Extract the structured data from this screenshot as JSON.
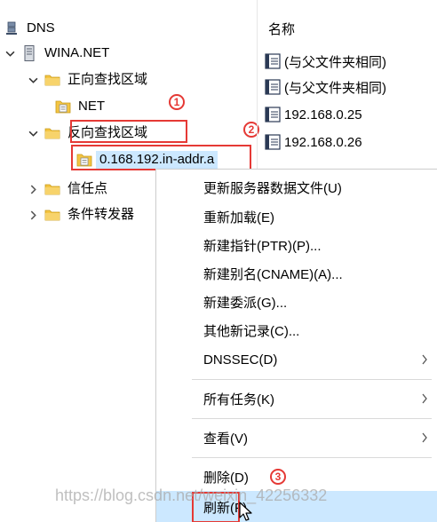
{
  "tree": {
    "root": {
      "label": "DNS",
      "icon": "dns-server-icon"
    },
    "server": {
      "label": "WINA.NET",
      "icon": "server-icon"
    },
    "forward_zones": {
      "label": "正向查找区域",
      "icon": "folder-icon"
    },
    "forward_zone_net": {
      "label": "NET",
      "icon": "zone-icon"
    },
    "reverse_zones": {
      "label": "反向查找区域",
      "icon": "folder-icon"
    },
    "reverse_zone_selected": {
      "label": "0.168.192.in-addr.a",
      "icon": "zone-icon"
    },
    "trust_points": {
      "label": "信任点",
      "icon": "folder-icon"
    },
    "conditional_forwarders": {
      "label": "条件转发器",
      "icon": "folder-icon"
    }
  },
  "list": {
    "header": "名称",
    "items": [
      {
        "label": "(与父文件夹相同)",
        "icon": "record-icon"
      },
      {
        "label": "(与父文件夹相同)",
        "icon": "record-icon"
      },
      {
        "label": "192.168.0.25",
        "icon": "record-icon"
      },
      {
        "label": "192.168.0.26",
        "icon": "record-icon"
      }
    ]
  },
  "context_menu": {
    "items": [
      {
        "label": "更新服务器数据文件(U)",
        "has_submenu": false
      },
      {
        "label": "重新加载(E)",
        "has_submenu": false
      },
      {
        "label": "新建指针(PTR)(P)...",
        "has_submenu": false
      },
      {
        "label": "新建别名(CNAME)(A)...",
        "has_submenu": false
      },
      {
        "label": "新建委派(G)...",
        "has_submenu": false
      },
      {
        "label": "其他新记录(C)...",
        "has_submenu": false
      },
      {
        "label": "DNSSEC(D)",
        "has_submenu": true
      },
      {
        "label": "所有任务(K)",
        "has_submenu": true
      },
      {
        "label": "查看(V)",
        "has_submenu": true
      },
      {
        "label": "删除(D)",
        "has_submenu": false
      },
      {
        "label": "刷新(F)",
        "has_submenu": false,
        "highlighted": true
      }
    ]
  },
  "annotations": {
    "badge_1": "1",
    "badge_2": "2",
    "badge_3": "3"
  },
  "watermark": "https://blog.csdn.net/weixin_42256332",
  "colors": {
    "highlight_red": "#e53935",
    "selection_blue": "#cce8ff",
    "folder_yellow": "#f4c542"
  }
}
